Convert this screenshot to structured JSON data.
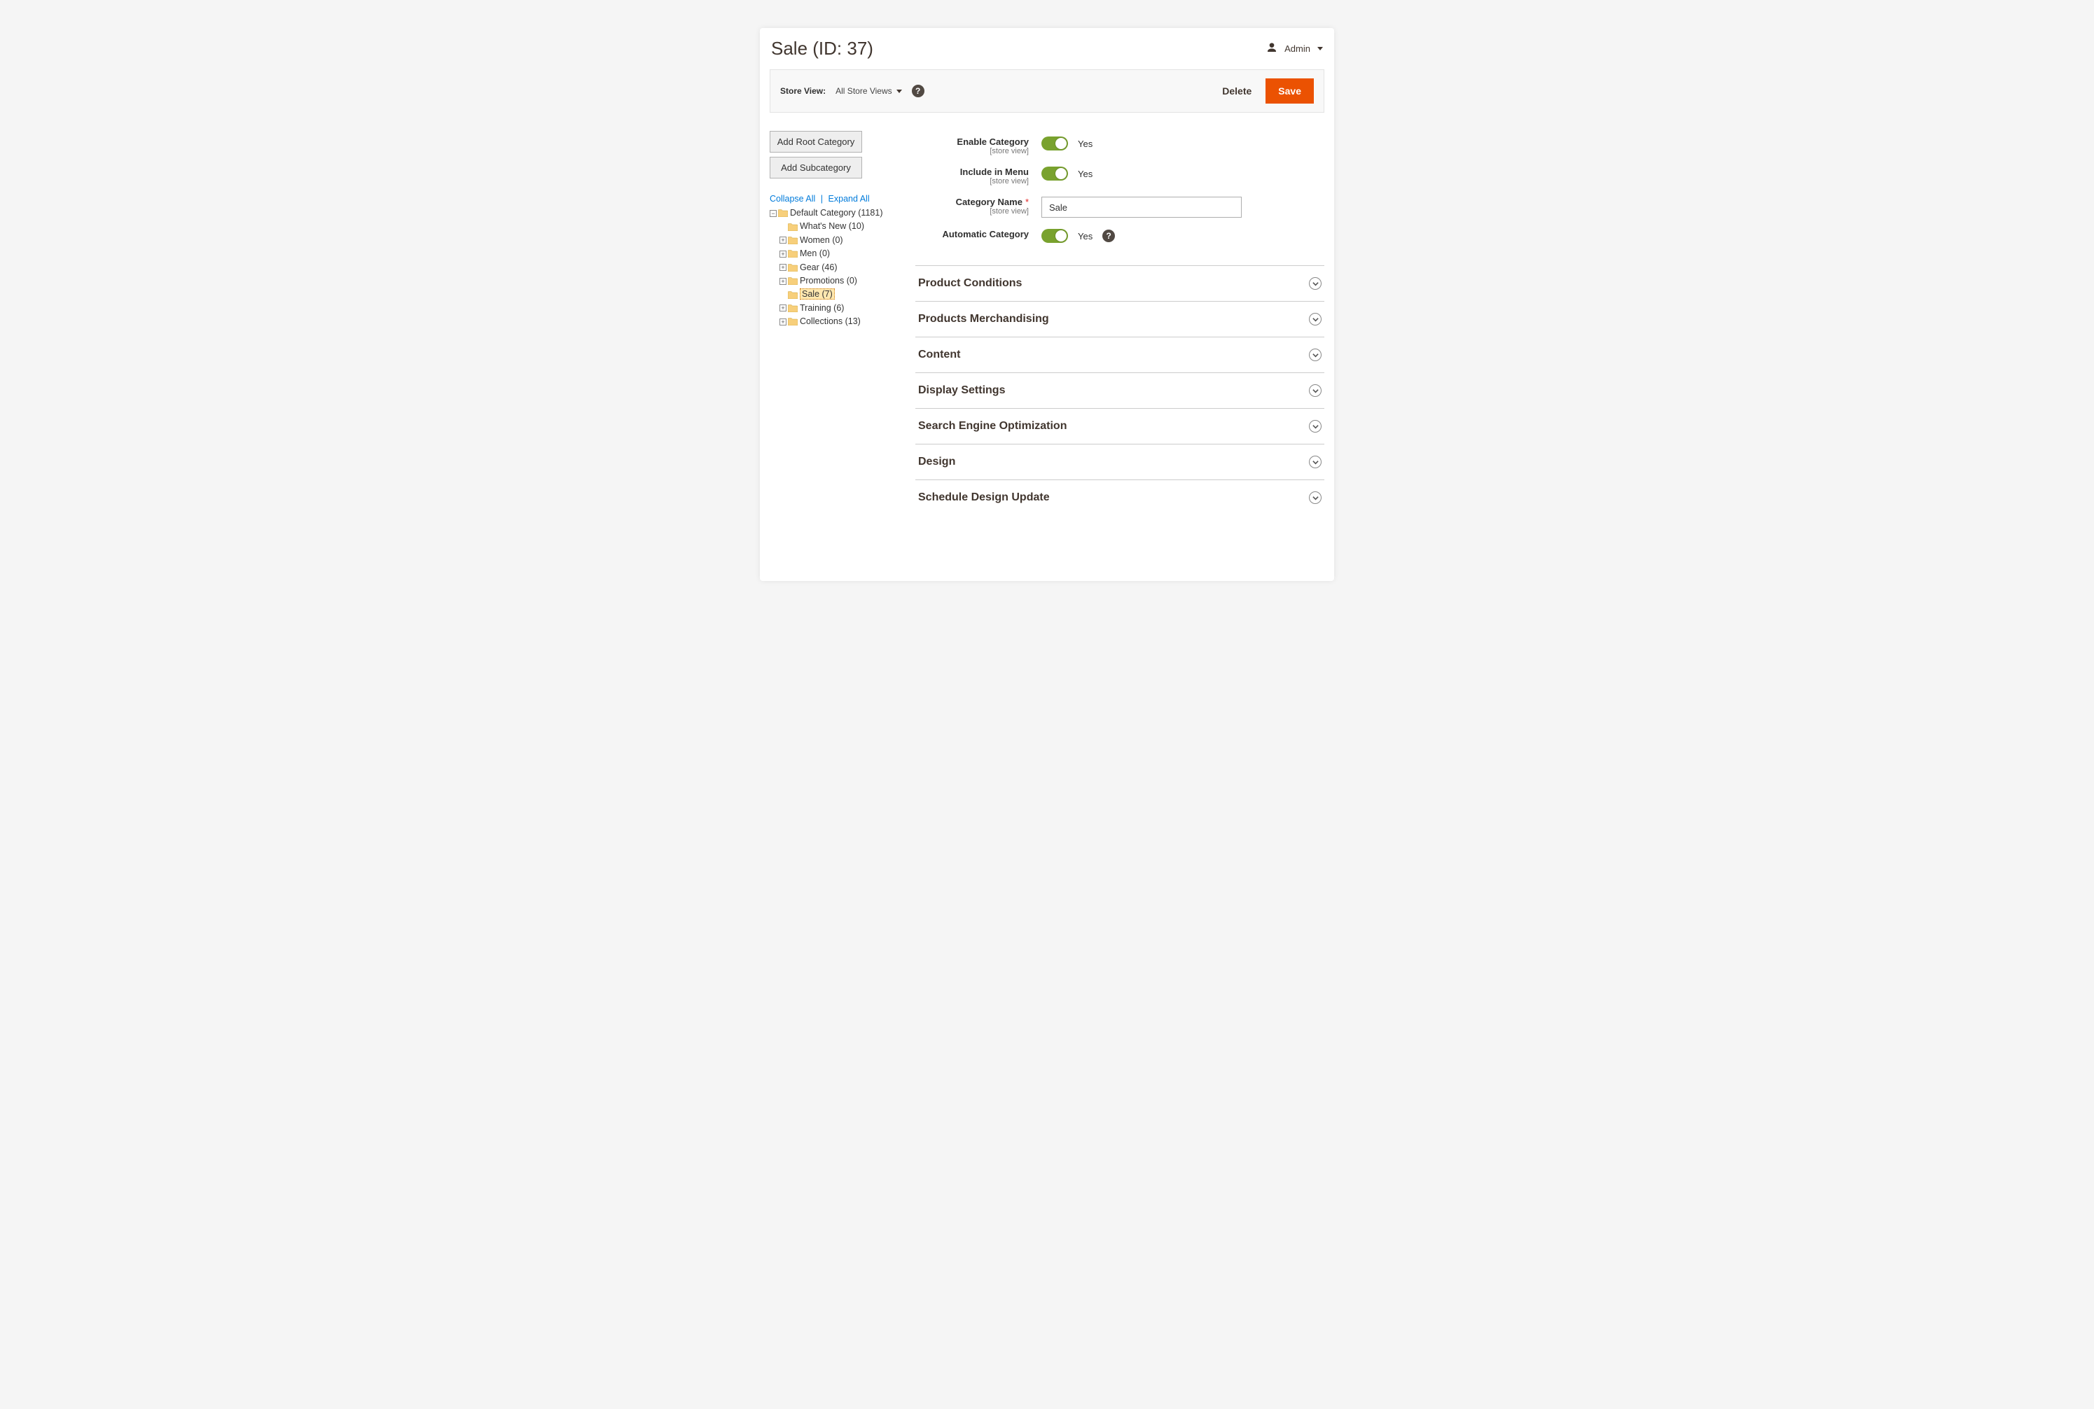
{
  "header": {
    "page_title": "Sale (ID: 37)",
    "admin_label": "Admin"
  },
  "action_bar": {
    "store_view_label": "Store View:",
    "store_view_value": "All Store Views",
    "delete_label": "Delete",
    "save_label": "Save"
  },
  "sidebar": {
    "add_root_label": "Add Root Category",
    "add_sub_label": "Add Subcategory",
    "collapse_label": "Collapse All",
    "expand_label": "Expand All",
    "separator": " | ",
    "tree": {
      "root": "Default Category (1181)",
      "children": [
        "What's New (10)",
        "Women (0)",
        "Men (0)",
        "Gear (46)",
        "Promotions (0)",
        "Sale (7)",
        "Training (6)",
        "Collections (13)"
      ]
    }
  },
  "form": {
    "enable_label": "Enable Category",
    "enable_scope": "[store view]",
    "enable_value": "Yes",
    "menu_label": "Include in Menu",
    "menu_scope": "[store view]",
    "menu_value": "Yes",
    "name_label": "Category Name",
    "name_scope": "[store view]",
    "name_value": "Sale",
    "auto_label": "Automatic Category",
    "auto_value": "Yes"
  },
  "sections": [
    "Product Conditions",
    "Products Merchandising",
    "Content",
    "Display Settings",
    "Search Engine Optimization",
    "Design",
    "Schedule Design Update"
  ]
}
